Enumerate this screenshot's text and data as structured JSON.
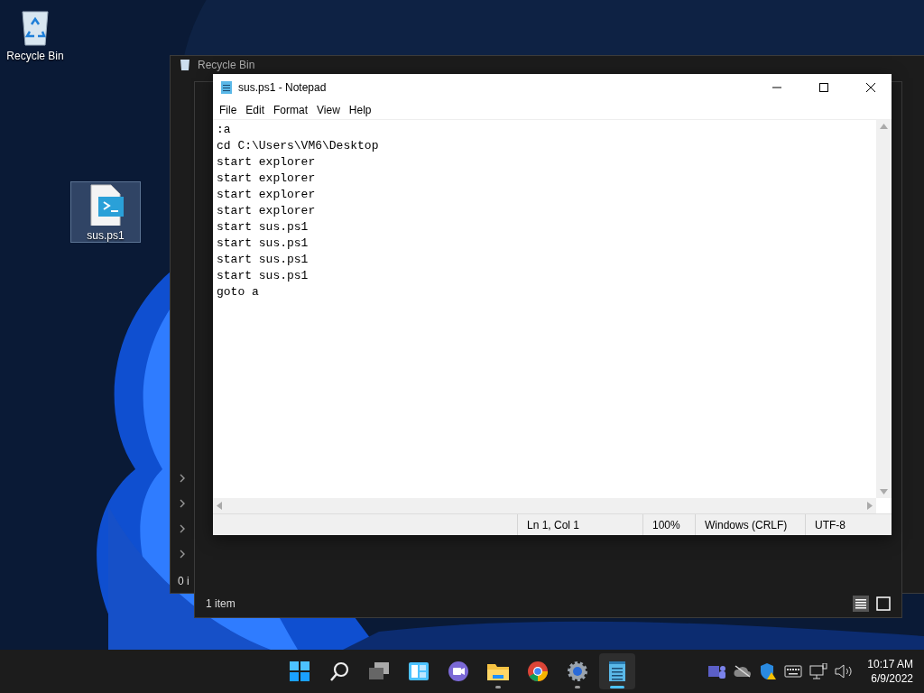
{
  "desktop": {
    "icons": [
      {
        "kind": "recycle",
        "label": "Recycle Bin",
        "selected": false
      },
      {
        "kind": "script",
        "label": "sus.ps1",
        "selected": true
      }
    ]
  },
  "back_window": {
    "title": "Recycle Bin",
    "status": "0 i"
  },
  "explorer_window": {
    "status": "1 item"
  },
  "notepad": {
    "title": "sus.ps1 - Notepad",
    "menu": [
      "File",
      "Edit",
      "Format",
      "View",
      "Help"
    ],
    "lines": [
      ":a",
      "cd C:\\Users\\VM6\\Desktop",
      "start explorer",
      "start explorer",
      "start explorer",
      "start explorer",
      "start sus.ps1",
      "start sus.ps1",
      "start sus.ps1",
      "start sus.ps1",
      "goto a"
    ],
    "status": {
      "position": "Ln 1, Col 1",
      "zoom": "100%",
      "line_ending": "Windows (CRLF)",
      "encoding": "UTF-8"
    }
  },
  "taskbar": {
    "apps": [
      {
        "kind": "start",
        "running": false,
        "selected": false
      },
      {
        "kind": "search",
        "running": false,
        "selected": false
      },
      {
        "kind": "taskview",
        "running": false,
        "selected": false
      },
      {
        "kind": "widgets",
        "running": false,
        "selected": false
      },
      {
        "kind": "chat",
        "running": false,
        "selected": false
      },
      {
        "kind": "files",
        "running": true,
        "selected": false
      },
      {
        "kind": "browser",
        "running": false,
        "selected": false
      },
      {
        "kind": "settings",
        "running": true,
        "selected": false
      },
      {
        "kind": "notepad",
        "running": true,
        "selected": true
      }
    ],
    "clock": {
      "time": "10:17 AM",
      "date": "6/9/2022"
    }
  }
}
